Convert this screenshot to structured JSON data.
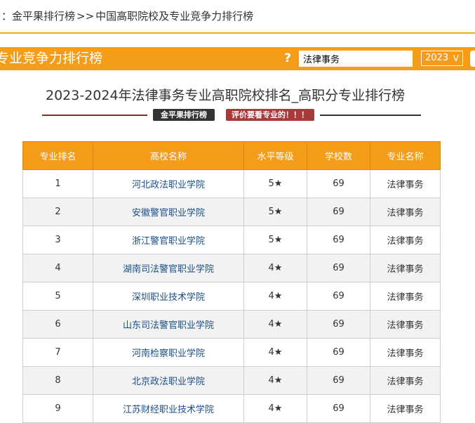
{
  "breadcrumb": {
    "home": "：金平果排行榜",
    "separator": ">>",
    "current": "中国高职院校及专业竞争力排行榜"
  },
  "banner": {
    "title": "专业竞争力排行榜",
    "help_icon": "?",
    "search_value": "法律事务",
    "year_selected": "2023",
    "chevron": "V"
  },
  "page": {
    "title": "2023-2024年法律事务专业高职院校排名_高职分专业排行榜",
    "brand_tag": "金平果排行榜",
    "review_tag": "评价要看专业的！！！"
  },
  "table": {
    "headers": [
      "专业排名",
      "高校名称",
      "水平等级",
      "学校数",
      "专业名称"
    ],
    "rows": [
      {
        "rank": "1",
        "school": "河北政法职业学院",
        "level": "5★",
        "count": "69",
        "major": "法律事务"
      },
      {
        "rank": "2",
        "school": "安徽警官职业学院",
        "level": "5★",
        "count": "69",
        "major": "法律事务"
      },
      {
        "rank": "3",
        "school": "浙江警官职业学院",
        "level": "5★",
        "count": "69",
        "major": "法律事务"
      },
      {
        "rank": "4",
        "school": "湖南司法警官职业学院",
        "level": "4★",
        "count": "69",
        "major": "法律事务"
      },
      {
        "rank": "5",
        "school": "深圳职业技术学院",
        "level": "4★",
        "count": "69",
        "major": "法律事务"
      },
      {
        "rank": "6",
        "school": "山东司法警官职业学院",
        "level": "4★",
        "count": "69",
        "major": "法律事务"
      },
      {
        "rank": "7",
        "school": "河南检察职业学院",
        "level": "4★",
        "count": "69",
        "major": "法律事务"
      },
      {
        "rank": "8",
        "school": "北京政法职业学院",
        "level": "4★",
        "count": "69",
        "major": "法律事务"
      },
      {
        "rank": "9",
        "school": "江苏财经职业技术学院",
        "level": "4★",
        "count": "69",
        "major": "法律事务"
      }
    ]
  }
}
